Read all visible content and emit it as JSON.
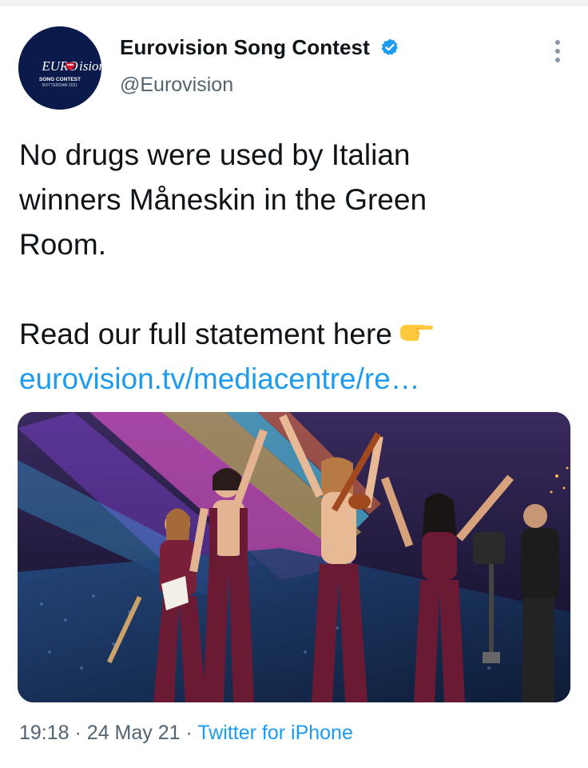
{
  "tweet": {
    "author": {
      "display_name": "Eurovision Song Contest",
      "handle": "@Eurovision",
      "verified": true,
      "avatar_logo": {
        "wordmark": "EUROVISION",
        "line1": "SONG CONTEST",
        "line2": "ROTTERDAM 2021",
        "background_color": "#0a1a4a"
      }
    },
    "text_line1": "No drugs were used by Italian",
    "text_line2": "winners Måneskin in the Green",
    "text_line3": "Room.",
    "text_line4": "Read our full statement here",
    "text_emoji": "backhand-index-pointing-right-emoji",
    "link_text": "eurovision.tv/mediacentre/re…",
    "media": {
      "kind": "photo",
      "subject": "performers-on-stage-photo"
    },
    "time": "19:18",
    "separator": "·",
    "date": "24 May 21",
    "source": "Twitter for iPhone"
  },
  "colors": {
    "link": "#1d9bf0",
    "secondary_text": "#536471",
    "verified_badge": "#1d9bf0"
  },
  "icons": {
    "verified": "verified-badge-icon",
    "more": "more-vertical-icon"
  }
}
